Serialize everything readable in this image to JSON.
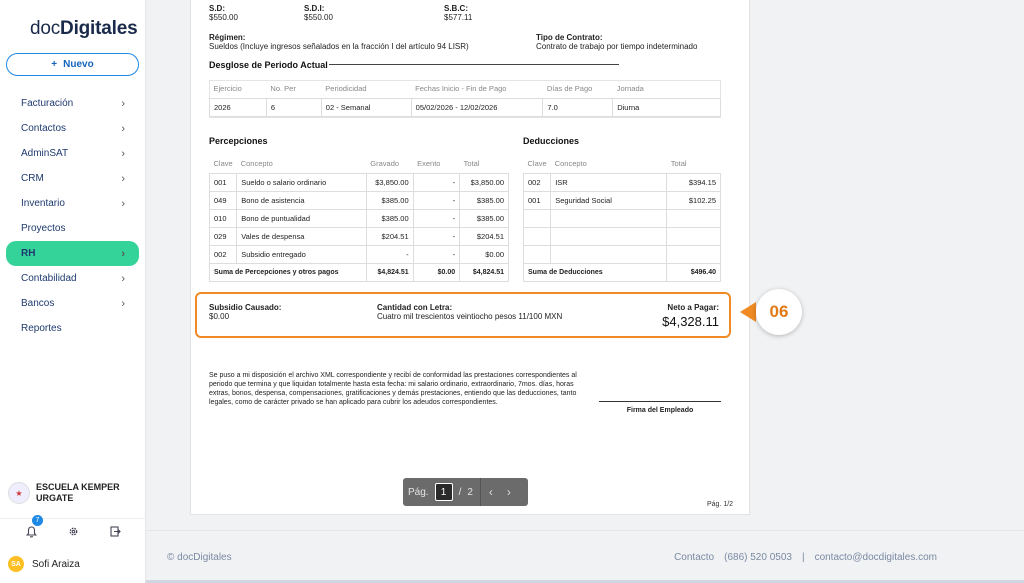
{
  "logo": {
    "prefix": "doc",
    "brand": "Digitales"
  },
  "new_button": {
    "icon": "+",
    "label": "Nuevo"
  },
  "nav": [
    {
      "label": "Facturación",
      "chevron": true,
      "active": false
    },
    {
      "label": "Contactos",
      "chevron": true,
      "active": false
    },
    {
      "label": "AdminSAT",
      "chevron": true,
      "active": false
    },
    {
      "label": "CRM",
      "chevron": true,
      "active": false
    },
    {
      "label": "Inventario",
      "chevron": true,
      "active": false
    },
    {
      "label": "Proyectos",
      "chevron": false,
      "active": false
    },
    {
      "label": "RH",
      "chevron": true,
      "active": true
    },
    {
      "label": "Contabilidad",
      "chevron": true,
      "active": false
    },
    {
      "label": "Bancos",
      "chevron": true,
      "active": false
    },
    {
      "label": "Reportes",
      "chevron": false,
      "active": false
    }
  ],
  "org": {
    "line1": "ESCUELA KEMPER",
    "line2": "URGATE"
  },
  "notifications": {
    "count": "7"
  },
  "user": {
    "initials": "SA",
    "name": "Sofi Araiza"
  },
  "doc": {
    "sd_label": "S.D:",
    "sd_value": "$550.00",
    "sdi_label": "S.D.I:",
    "sdi_value": "$550.00",
    "sbc_label": "S.B.C:",
    "sbc_value": "$577.11",
    "regimen_label": "Régimen:",
    "regimen_value": "Sueldos (Incluye ingresos señalados en la fracción I del artículo 94 LISR)",
    "contrato_label": "Tipo de Contrato:",
    "contrato_value": "Contrato de trabajo por tiempo indeterminado",
    "desglose_title": "Desglose de Periodo Actual",
    "periodo_headers": [
      "Ejercicio",
      "No. Per",
      "Periodicidad",
      "Fechas Inicio - Fin de Pago",
      "Días de Pago",
      "Jornada"
    ],
    "periodo_row": [
      "2026",
      "6",
      "02 - Semanal",
      "05/02/2026 - 12/02/2026",
      "7.0",
      "Diurna"
    ],
    "perc_title": "Percepciones",
    "perc_headers": [
      "Clave",
      "Concepto",
      "Gravado",
      "Exento",
      "Total"
    ],
    "perc_rows": [
      [
        "001",
        "Sueldo o salario ordinario",
        "$3,850.00",
        "-",
        "$3,850.00"
      ],
      [
        "049",
        "Bono de asistencia",
        "$385.00",
        "-",
        "$385.00"
      ],
      [
        "010",
        "Bono de puntualidad",
        "$385.00",
        "-",
        "$385.00"
      ],
      [
        "029",
        "Vales de despensa",
        "$204.51",
        "-",
        "$204.51"
      ],
      [
        "002",
        "Subsidio entregado",
        "-",
        "-",
        "$0.00"
      ]
    ],
    "perc_sum": [
      "Suma de Percepciones y otros pagos",
      "$4,824.51",
      "$0.00",
      "$4,824.51"
    ],
    "ded_title": "Deducciones",
    "ded_headers": [
      "Clave",
      "Concepto",
      "Total"
    ],
    "ded_rows": [
      [
        "002",
        "ISR",
        "$394.15"
      ],
      [
        "001",
        "Seguridad Social",
        "$102.25"
      ],
      [
        "",
        "",
        ""
      ],
      [
        "",
        "",
        ""
      ],
      [
        "",
        "",
        ""
      ]
    ],
    "ded_sum": [
      "Suma de Deducciones",
      "$496.40"
    ],
    "subsidio_label": "Subsidio Causado:",
    "subsidio_value": "$0.00",
    "letra_label": "Cantidad con Letra:",
    "letra_value": "Cuatro mil trescientos veintiocho pesos 11/100 MXN",
    "neto_label": "Neto a Pagar:",
    "neto_value": "$4,328.11",
    "legal_text": "Se puso a mi disposición el archivo XML correspondiente y recibí de conformidad las prestaciones correspondientes al periodo que termina y que liquidan totalmente hasta esta fecha: mi salario ordinario, extraordinario, 7mos. días, horas extras, bonos, despensa, compensaciones, gratificaciones y demás prestaciones, entiendo que las deducciones, tanto legales, como de carácter privado se han aplicado para cubrir los adeudos correspondientes.",
    "firma_label": "Firma del Empleado",
    "page_footer": "Pág. 1/2"
  },
  "step_marker": "06",
  "pager": {
    "label": "Pág.",
    "current": "1",
    "sep": "/",
    "total": "2"
  },
  "footer": {
    "copyright": "© docDigitales",
    "contact_label": "Contacto",
    "phone": "(686) 520 0503",
    "divider": "|",
    "email": "contacto@docdigitales.com"
  }
}
